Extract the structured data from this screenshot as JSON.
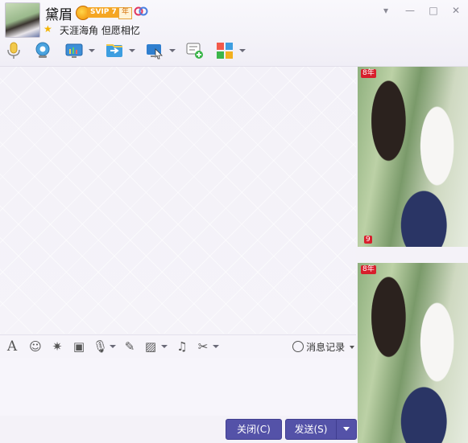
{
  "contact": {
    "name": "黛眉",
    "vip_badge": "SVIP 7",
    "year_badge": "年",
    "signature": "天涯海角 但愿相忆"
  },
  "window": {
    "menu_glyph": "▾",
    "minimize_glyph": "—",
    "maximize_glyph": "□",
    "close_glyph": "✕"
  },
  "toolbar": {
    "icons": [
      "microphone-icon",
      "video-call-icon",
      "screen-share-icon",
      "file-transfer-icon",
      "remote-desktop-icon",
      "new-message-icon",
      "apps-icon"
    ]
  },
  "input_toolbar": {
    "font_glyph": "A",
    "emoji_glyph": "☺",
    "shake_glyph": "✷",
    "screenshot_glyph": "▣",
    "voice_glyph": "🎙",
    "edit_glyph": "✎",
    "image_glyph": "▨",
    "music_glyph": "♫",
    "scissors_glyph": "✂",
    "history_label": "消息记录"
  },
  "buttons": {
    "close_label": "关闭(C)",
    "send_label": "发送(S)"
  },
  "side_panel": {
    "photo_badge": "8年",
    "thumb_badge": "9"
  },
  "colors": {
    "accent": "#5452a8",
    "background": "#f4f2f8"
  }
}
